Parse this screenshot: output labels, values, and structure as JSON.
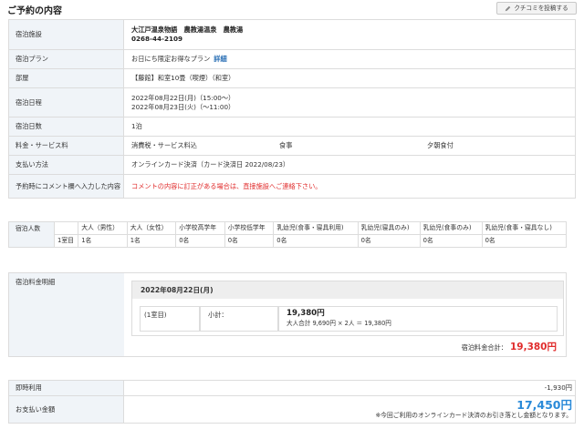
{
  "page": {
    "title": "ご予約の内容",
    "review_button": "クチコミを投稿する",
    "review_icon": "pencil-icon"
  },
  "info": {
    "facility_label": "宿泊施設",
    "facility_name": "大江戸温泉物語　農教湯温泉　農教湯",
    "facility_phone": "0268-44-2109",
    "plan_label": "宿泊プラン",
    "plan_text": "お日にち限定お得なプラン",
    "plan_link": "詳細",
    "room_label": "部屋",
    "room_text": "【藤館】和室10畳（喫煙）（和室）",
    "dates_label": "宿泊日程",
    "checkin": "2022年08月22日(月)（15:00〜）",
    "checkout": "2022年08月23日(火)（〜11:00）",
    "nights_label": "宿泊日数",
    "nights_value": "1泊",
    "fee_label": "料金・サービス料",
    "fee_tax": "消費税・サービス料込",
    "fee_meal_label": "食事",
    "fee_meal_value": "夕朝食付",
    "payment_label": "支払い方法",
    "payment_value": "オンラインカード決済（カード決済日 2022/08/23）",
    "comment_label": "予約時にコメント欄へ入力した内容",
    "comment_value": "コメントの内容に訂正がある場合は、直接施設へご連絡下さい。"
  },
  "guests": {
    "label": "宿泊人数",
    "headers": [
      "大人（男性）",
      "大人（女性）",
      "小学校高学年",
      "小学校低学年",
      "乳幼児(食事・寝具利用)",
      "乳幼児(寝具のみ)",
      "乳幼児(食事のみ)",
      "乳幼児(食事・寝具なし)"
    ],
    "room": "1室目",
    "values": [
      "1名",
      "1名",
      "0名",
      "0名",
      "0名",
      "0名",
      "0名",
      "0名"
    ]
  },
  "fee_detail": {
    "label": "宿泊料金明細",
    "date": "2022年08月22日(月)",
    "room": "(1室目)",
    "subtotal_label": "小計：",
    "subtotal_value": "19,380円",
    "calc": "大人合計 9,690円 × 2人 ＝ 19,380円",
    "total_label": "宿泊料金合計：",
    "total_value": "19,380円"
  },
  "payment": {
    "discount_label": "即時利用",
    "discount_value": "-1,930円",
    "amount_label": "お支払い金額",
    "amount_value": "17,450円",
    "amount_note": "※今回ご利用のオンラインカード決済のお引き落とし金額となります。"
  }
}
